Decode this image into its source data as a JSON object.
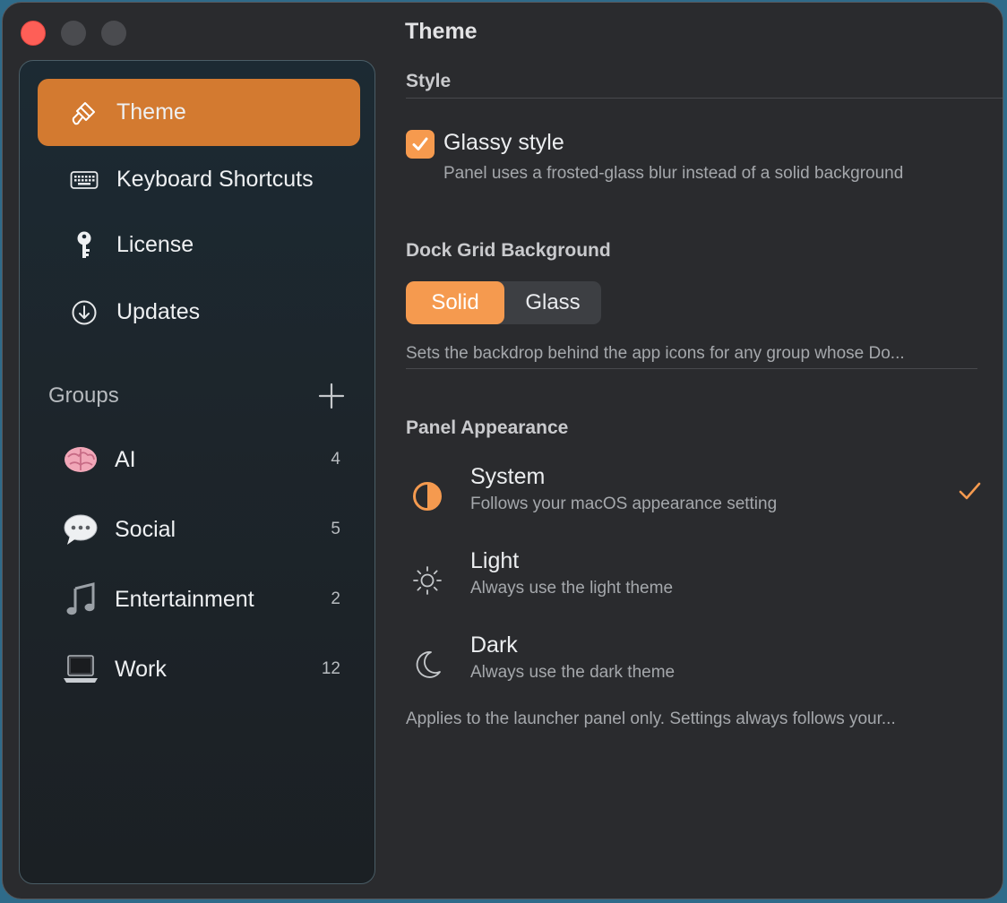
{
  "window": {
    "title": "Theme"
  },
  "sidebar": {
    "nav_items": [
      {
        "label": "Theme",
        "icon": "paintbrush-icon",
        "active": true
      },
      {
        "label": "Keyboard Shortcuts",
        "icon": "keyboard-icon",
        "active": false
      },
      {
        "label": "License",
        "icon": "key-icon",
        "active": false
      },
      {
        "label": "Updates",
        "icon": "download-circle-icon",
        "active": false
      }
    ],
    "groups_header": "Groups",
    "groups": [
      {
        "label": "AI",
        "count": "4",
        "icon": "brain-emoji"
      },
      {
        "label": "Social",
        "count": "5",
        "icon": "speech-bubble-emoji"
      },
      {
        "label": "Entertainment",
        "count": "2",
        "icon": "music-notes-emoji"
      },
      {
        "label": "Work",
        "count": "12",
        "icon": "laptop-emoji"
      }
    ]
  },
  "style_section": {
    "title": "Style",
    "glassy_label": "Glassy style",
    "glassy_checked": true,
    "glassy_description": "Panel uses a frosted-glass blur instead of a solid background"
  },
  "dock_grid": {
    "title": "Dock Grid Background",
    "options": [
      "Solid",
      "Glass"
    ],
    "selected": "Solid",
    "description": "Sets the backdrop behind the app icons for any group whose Do..."
  },
  "panel_appearance": {
    "title": "Panel Appearance",
    "options": [
      {
        "title": "System",
        "subtitle": "Follows your macOS appearance setting",
        "icon": "half-circle-icon",
        "selected": true
      },
      {
        "title": "Light",
        "subtitle": "Always use the light theme",
        "icon": "sun-icon",
        "selected": false
      },
      {
        "title": "Dark",
        "subtitle": "Always use the dark theme",
        "icon": "moon-icon",
        "selected": false
      }
    ],
    "footnote": "Applies to the launcher panel only. Settings always follows your..."
  },
  "colors": {
    "accent": "#f59a4f",
    "sidebar_active": "#d37a30",
    "window_bg": "#2a2b2e"
  }
}
